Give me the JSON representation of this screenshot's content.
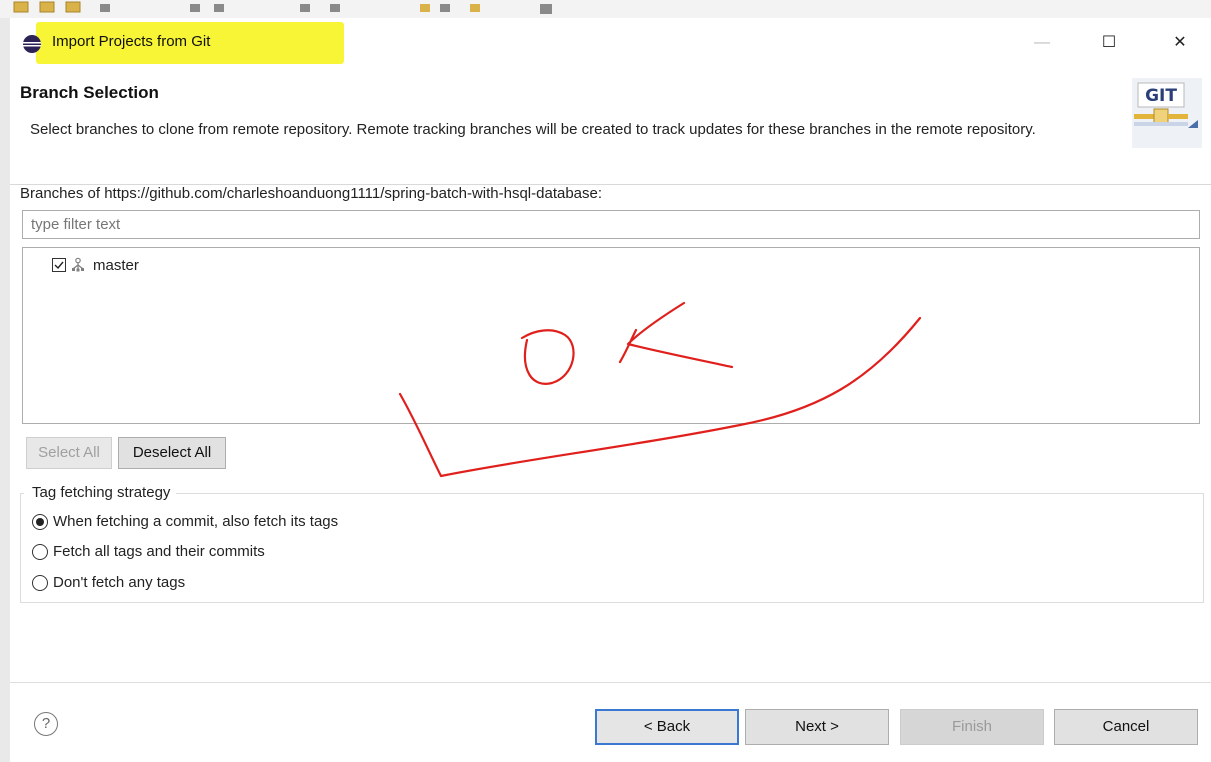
{
  "window": {
    "title": "Import Projects from Git",
    "title_highlight_color": "#f7f536",
    "controls": {
      "minimize": "—",
      "maximize": "☐",
      "close": "✕"
    }
  },
  "header": {
    "heading": "Branch Selection",
    "description": "Select branches to clone from remote repository. Remote tracking branches will be created to track updates for these branches in the remote repository.",
    "logo_text": "GIT"
  },
  "branches": {
    "label": "Branches of https://github.com/charleshoanduong1111/spring-batch-with-hsql-database:",
    "filter_placeholder": "type filter text",
    "items": [
      {
        "label": "master",
        "checked": true
      }
    ],
    "select_all": "Select All",
    "deselect_all": "Deselect All"
  },
  "tag_fetching": {
    "legend": "Tag fetching strategy",
    "options": [
      {
        "label": "When fetching a commit, also fetch its tags",
        "selected": true
      },
      {
        "label": "Fetch all tags and their commits",
        "selected": false
      },
      {
        "label": "Don't fetch any tags",
        "selected": false
      }
    ]
  },
  "footer": {
    "help": "?",
    "back": "< Back",
    "next": "Next >",
    "finish": "Finish",
    "cancel": "Cancel"
  },
  "annotation": {
    "text": "OK",
    "color": "#e0201c"
  },
  "colors": {
    "accent": "#3b78d1",
    "disabled_text": "#a0a0a0"
  }
}
